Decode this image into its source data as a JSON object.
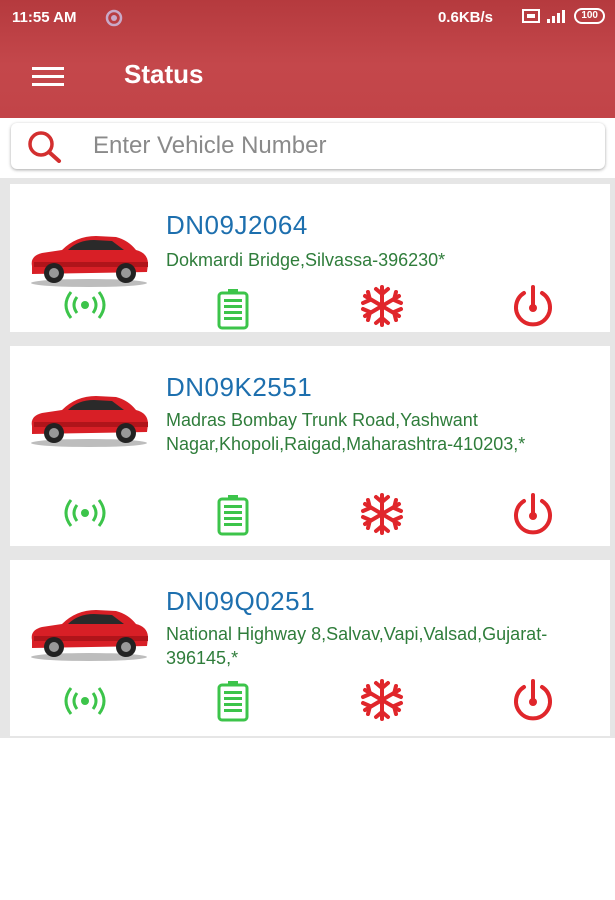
{
  "status_bar": {
    "time": "11:55 AM",
    "network_speed": "0.6KB/s",
    "battery": "100"
  },
  "header": {
    "title": "Status",
    "menu_icon": "hamburger-icon"
  },
  "search": {
    "placeholder": "Enter Vehicle Number",
    "icon": "search-icon"
  },
  "colors": {
    "header": "#c24448",
    "vehicle_number": "#1d6fae",
    "address": "#2f7d3b",
    "gps_ok": "#3cc44a",
    "battery_ok": "#3cc44a",
    "ac": "#e0262b",
    "ignition": "#e0262b"
  },
  "vehicles": [
    {
      "number": "DN09J2064",
      "address": "Dokmardi Bridge,Silvassa-396230*",
      "icons": [
        "gps-signal-icon",
        "battery-icon",
        "ac-snowflake-icon",
        "ignition-power-icon"
      ]
    },
    {
      "number": "DN09K2551",
      "address": "Madras Bombay Trunk Road,Yashwant Nagar,Khopoli,Raigad,Maharashtra-410203,*",
      "icons": [
        "gps-signal-icon",
        "battery-icon",
        "ac-snowflake-icon",
        "ignition-power-icon"
      ]
    },
    {
      "number": "DN09Q0251",
      "address": "National Highway 8,Salvav,Vapi,Valsad,Gujarat-396145,*",
      "icons": [
        "gps-signal-icon",
        "battery-icon",
        "ac-snowflake-icon",
        "ignition-power-icon"
      ]
    }
  ]
}
